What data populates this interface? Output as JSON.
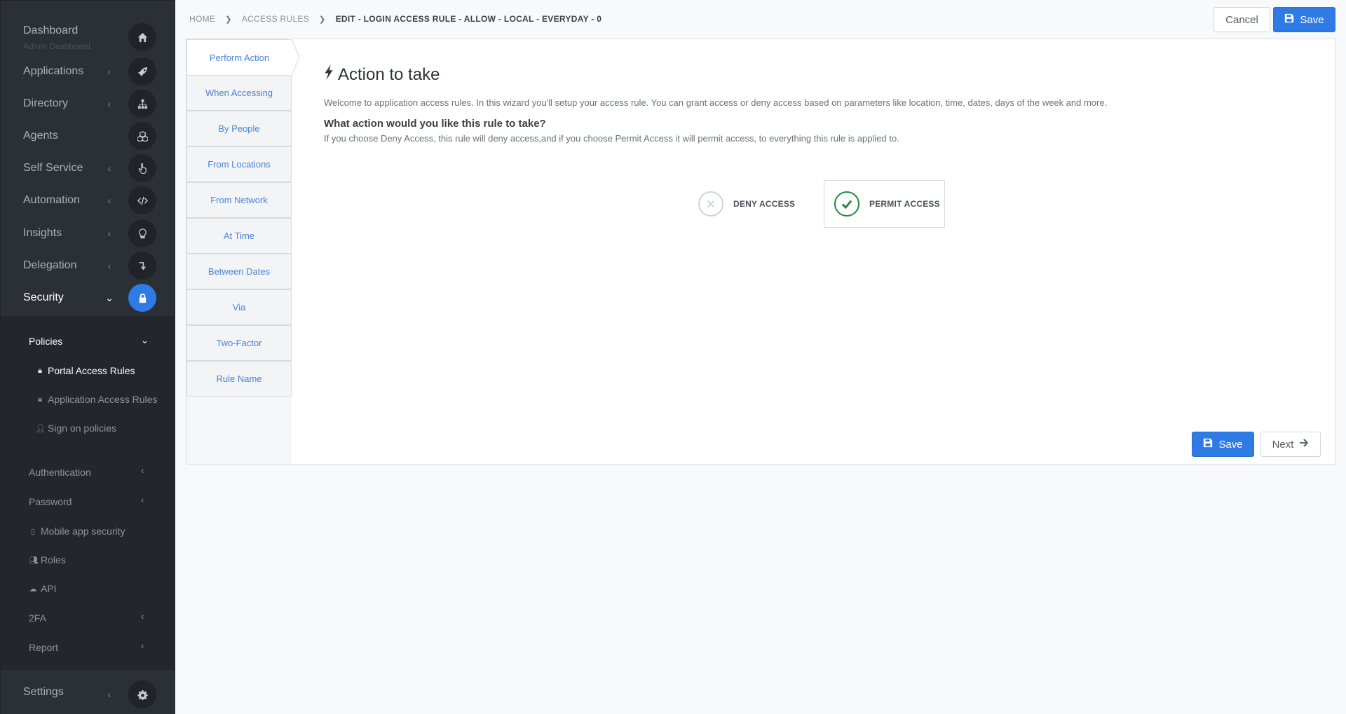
{
  "sidebar": {
    "dashboard": {
      "label": "Dashboard",
      "sublabel": "Admin Dashboard"
    },
    "items": [
      {
        "label": "Applications"
      },
      {
        "label": "Directory"
      },
      {
        "label": "Agents"
      },
      {
        "label": "Self Service"
      },
      {
        "label": "Automation"
      },
      {
        "label": "Insights"
      },
      {
        "label": "Delegation"
      },
      {
        "label": "Security"
      }
    ],
    "security_sub": {
      "policies": "Policies",
      "portal_access_rules": "Portal Access Rules",
      "application_access_rules": "Application Access Rules",
      "sign_on_policies": "Sign on policies",
      "authentication": "Authentication",
      "password": "Password",
      "mobile_app_security": "Mobile app security",
      "roles": "Roles",
      "api": "API",
      "twofa": "2FA",
      "report": "Report"
    },
    "settings": "Settings"
  },
  "breadcrumb": {
    "home": "HOME",
    "access_rules": "ACCESS RULES",
    "current": "EDIT - LOGIN ACCESS RULE - ALLOW - LOCAL - EVERYDAY - 0"
  },
  "toolbar": {
    "cancel_label": "Cancel",
    "save_label": "Save"
  },
  "wizard": {
    "steps": [
      "Perform Action",
      "When Accessing",
      "By People",
      "From Locations",
      "From Network",
      "At Time",
      "Between Dates",
      "Via",
      "Two-Factor",
      "Rule Name"
    ],
    "title": "Action to take",
    "intro": "Welcome to application access rules. In this wizard you'll setup your access rule. You can grant access or deny access based on parameters like location, time, dates, days of the week and more.",
    "question": "What action would you like this rule to take?",
    "hint": "If you choose Deny Access, this rule will deny access,and if you choose Permit Access it will permit access, to everything this rule is applied to.",
    "deny_label": "DENY ACCESS",
    "permit_label": "PERMIT ACCESS",
    "selected": "PERMIT ACCESS",
    "save_label": "Save",
    "next_label": "Next"
  },
  "colors": {
    "sidebar_bg": "#2b2f36",
    "subpanel_bg": "#23262c",
    "primary": "#2e7be6",
    "link": "#4a83d4",
    "success": "#1e8a3c"
  }
}
